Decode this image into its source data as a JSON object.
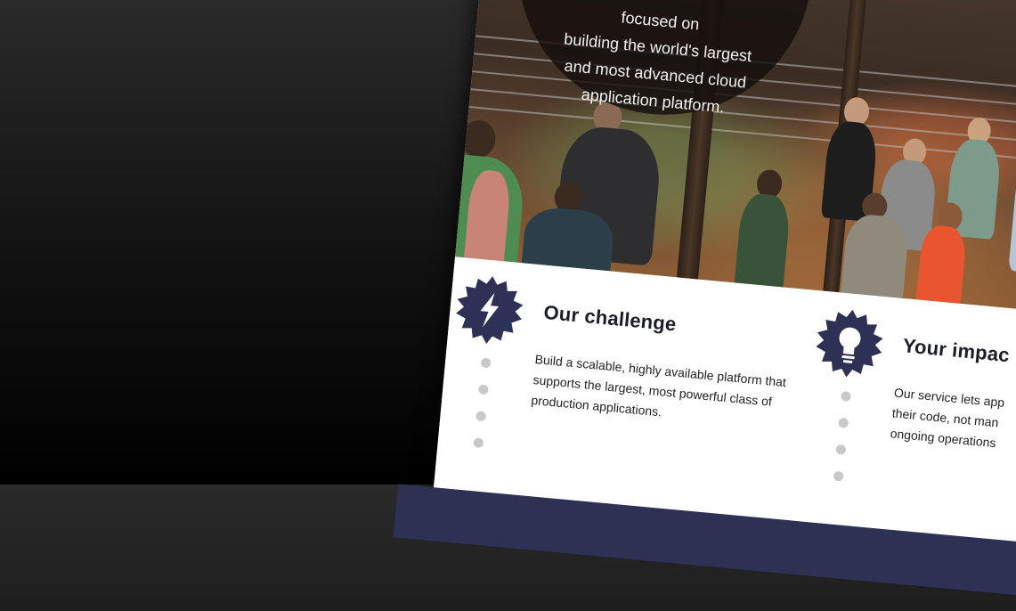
{
  "hero": {
    "headline_lines": [
      "focused on",
      "building the world's largest",
      "and most advanced cloud",
      "application platform."
    ]
  },
  "features": [
    {
      "title": "Our challenge",
      "icon": "lightning-icon",
      "body_lines": [
        "Build a scalable, highly available platform that",
        "supports the largest, most powerful class of",
        "production applications."
      ]
    },
    {
      "title": "Your impac",
      "icon": "lightbulb-icon",
      "body_lines": [
        "Our service lets app",
        "their code, not man",
        "ongoing operations"
      ]
    }
  ],
  "colors": {
    "badge": "#2d3156",
    "footer": "#2d3153",
    "dots": "#c9c9c9"
  }
}
